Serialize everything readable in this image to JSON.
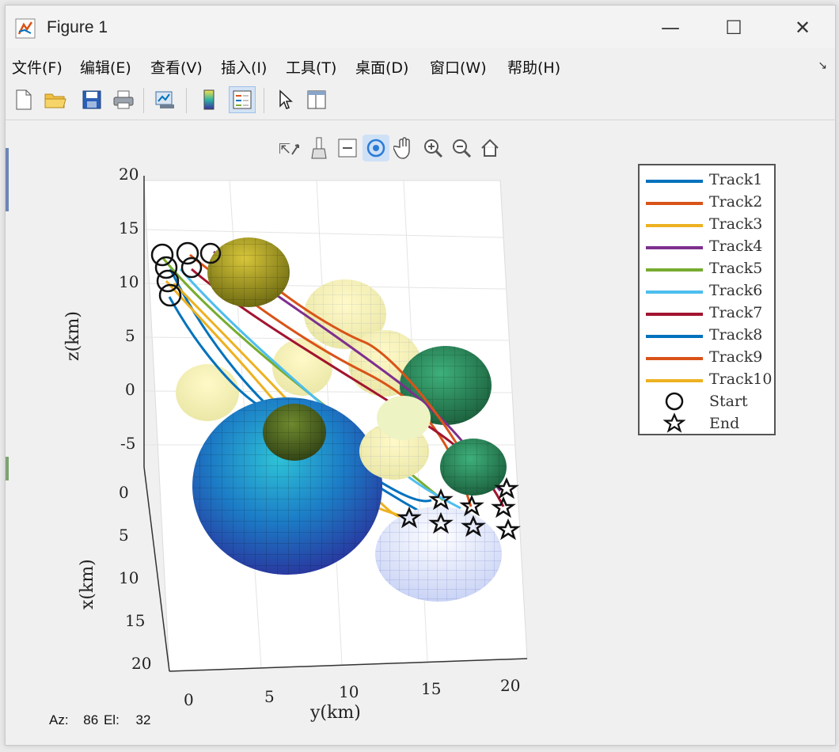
{
  "window": {
    "title": "Figure 1"
  },
  "controls": {
    "minimize": "—",
    "maximize": "☐",
    "close": "✕"
  },
  "menu": {
    "items": [
      "文件(F)",
      "编辑(E)",
      "查看(V)",
      "插入(I)",
      "工具(T)",
      "桌面(D)",
      "窗口(W)",
      "帮助(H)"
    ],
    "corner": "↘"
  },
  "toolbar": {
    "icons": [
      "new-file-icon",
      "open-folder-icon",
      "save-icon",
      "print-icon",
      "link-plot-icon",
      "colorbar-icon",
      "legend-icon",
      "pointer-icon",
      "property-editor-icon"
    ]
  },
  "axes_toolbar": {
    "icons": [
      "export-icon",
      "brush-icon",
      "datatip-icon",
      "rotate-icon",
      "pan-icon",
      "zoom-in-icon",
      "zoom-out-icon",
      "home-icon"
    ]
  },
  "colors": {
    "tracks": [
      "#0072bd",
      "#d95319",
      "#edb120",
      "#7e2f8e",
      "#77ac30",
      "#4dbeee",
      "#a2142f",
      "#0072bd",
      "#d95319",
      "#edb120"
    ]
  },
  "chart_data": {
    "type": "3d-trajectory",
    "xlabel": "x(km)",
    "ylabel": "y(km)",
    "zlabel": "z(km)",
    "z_ticks": [
      "20",
      "15",
      "10",
      "5",
      "0",
      "-5"
    ],
    "x_ticks": [
      "0",
      "5",
      "10",
      "15",
      "20"
    ],
    "y_ticks": [
      "0",
      "5",
      "10",
      "15",
      "20"
    ],
    "xlim": [
      0,
      20
    ],
    "ylim": [
      0,
      20
    ],
    "zlim": [
      -5,
      20
    ],
    "view": {
      "azimuth": 86,
      "elevation": 32
    },
    "legend": {
      "placement": "right",
      "entries": [
        "Track1",
        "Track2",
        "Track3",
        "Track4",
        "Track5",
        "Track6",
        "Track7",
        "Track8",
        "Track9",
        "Track10",
        "Start",
        "End"
      ]
    },
    "series_count": 10,
    "markers": {
      "start": "circle",
      "end": "pentagram"
    }
  },
  "status": {
    "az_label": "Az:",
    "az_value": "86",
    "el_label": "El:",
    "el_value": "32"
  }
}
